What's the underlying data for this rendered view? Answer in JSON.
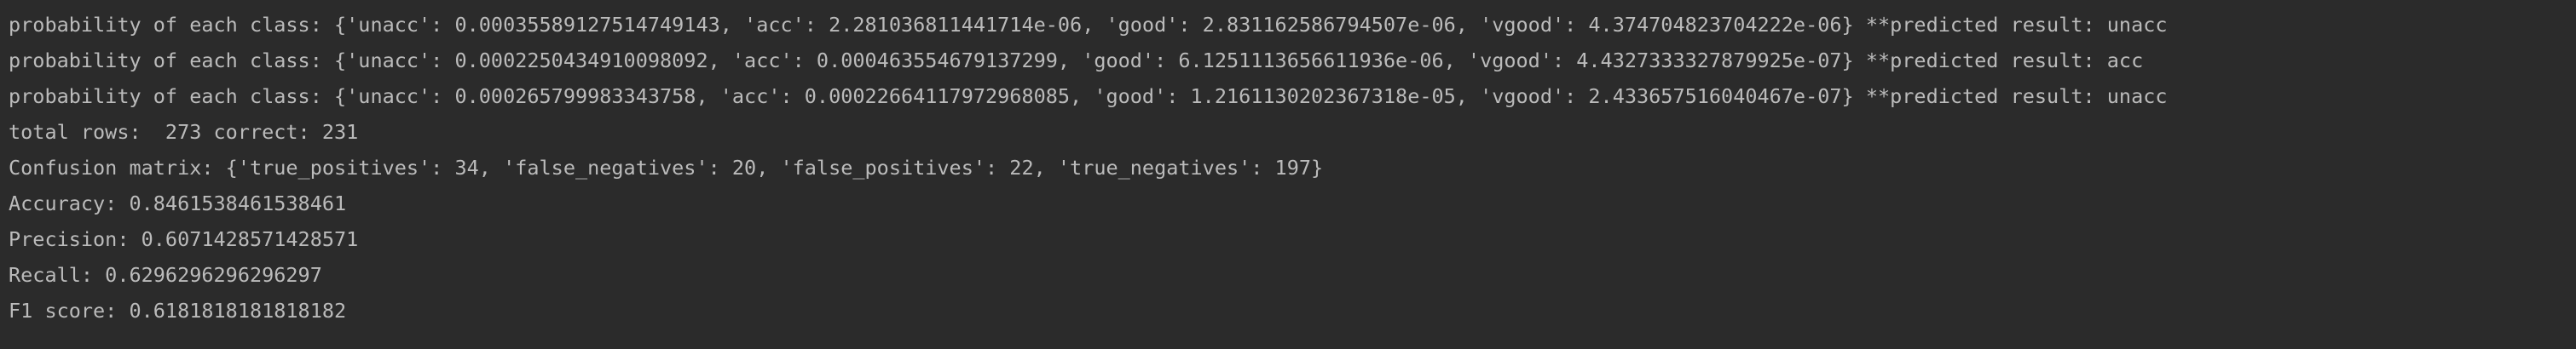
{
  "console": {
    "lines": [
      "probability of each class: {'unacc': 0.00035589127514749143, 'acc': 2.281036811441714e-06, 'good': 2.831162586794507e-06, 'vgood': 4.374704823704222e-06} **predicted result: unacc",
      "probability of each class: {'unacc': 0.0002250434910098092, 'acc': 0.000463554679137299, 'good': 6.1251113656611936e-06, 'vgood': 4.4327333327879925e-07} **predicted result: acc",
      "probability of each class: {'unacc': 0.000265799983343758, 'acc': 0.00022664117972968085, 'good': 1.2161130202367318e-05, 'vgood': 2.433657516040467e-07} **predicted result: unacc",
      "total rows:  273 correct: 231",
      "Confusion matrix: {'true_positives': 34, 'false_negatives': 20, 'false_positives': 22, 'true_negatives': 197}",
      "Accuracy: 0.8461538461538461",
      "Precision: 0.6071428571428571",
      "Recall: 0.6296296296296297",
      "F1 score: 0.6181818181818182"
    ]
  }
}
